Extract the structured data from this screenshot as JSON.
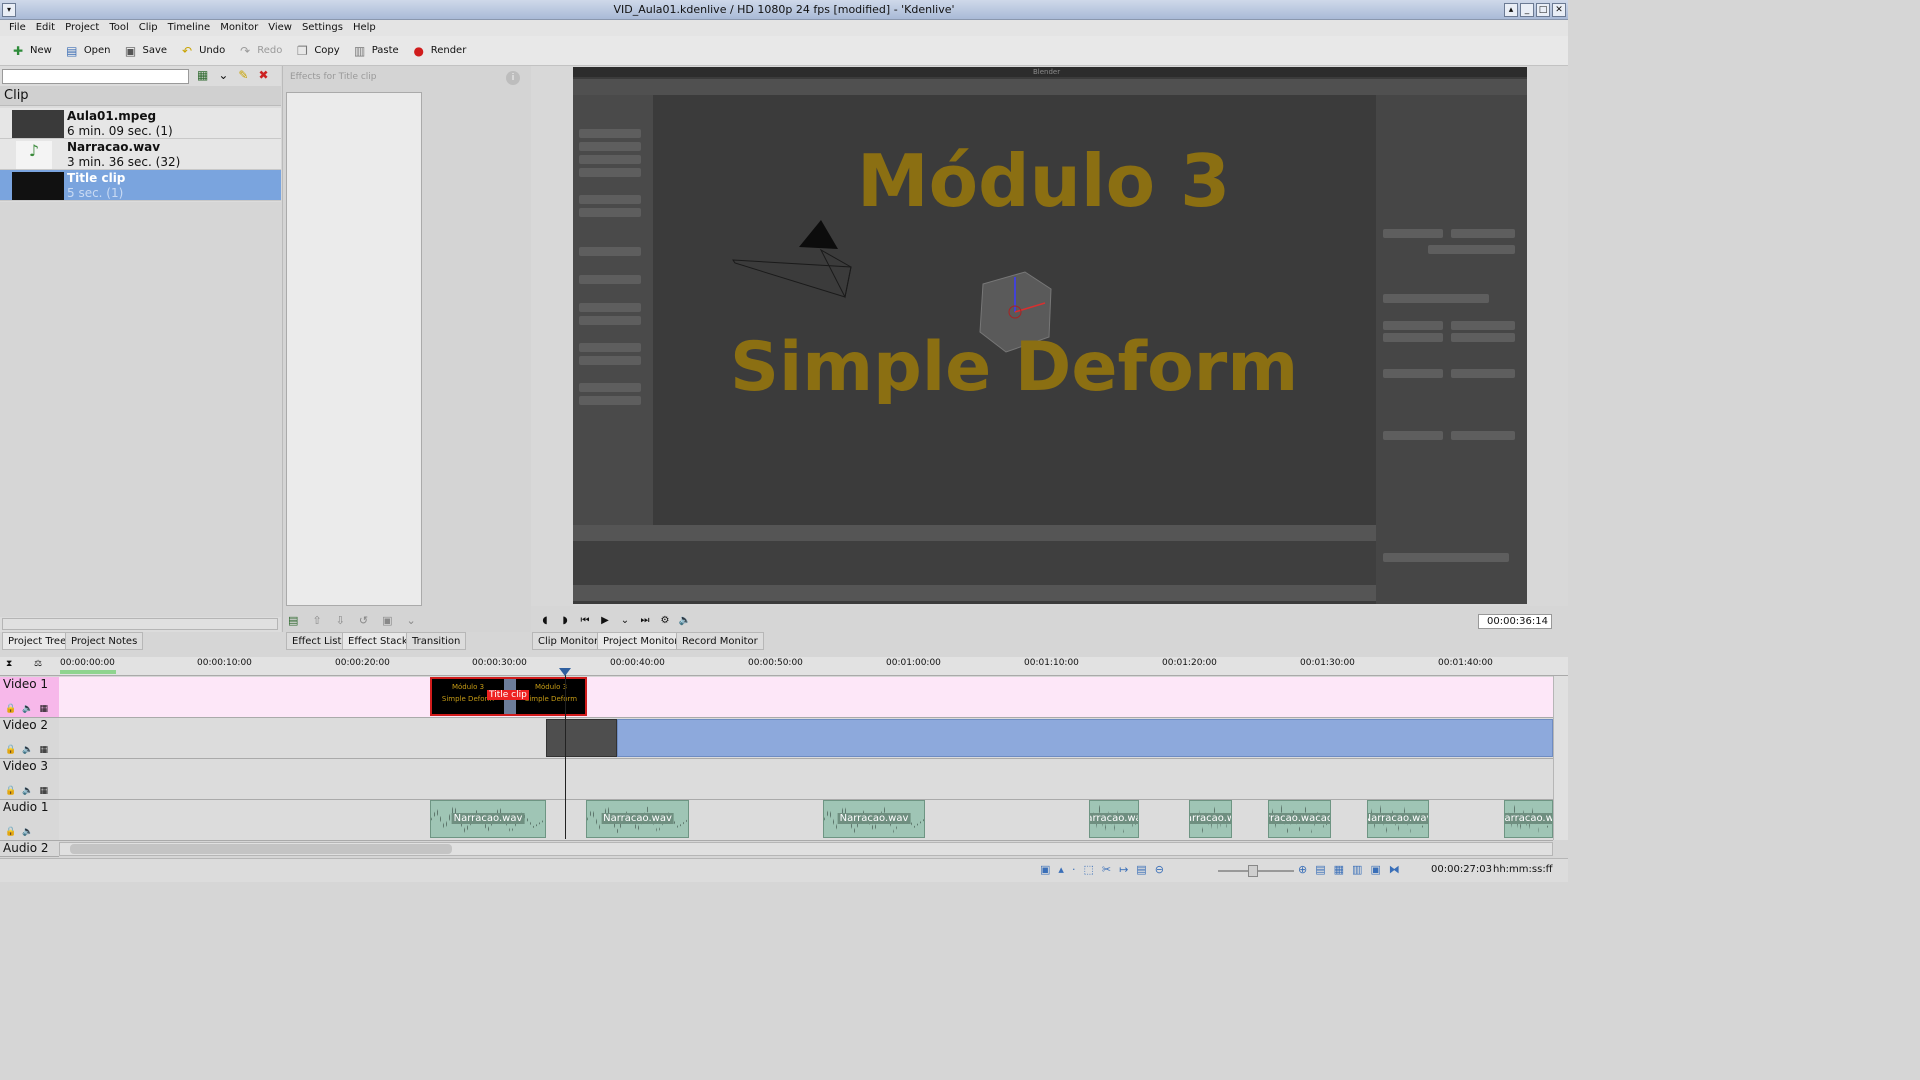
{
  "window": {
    "title": "VID_Aula01.kdenlive / HD 1080p 24 fps [modified] - 'Kdenlive'"
  },
  "menu": [
    "File",
    "Edit",
    "Project",
    "Tool",
    "Clip",
    "Timeline",
    "Monitor",
    "View",
    "Settings",
    "Help"
  ],
  "toolbar": {
    "new": "New",
    "open": "Open",
    "save": "Save",
    "undo": "Undo",
    "redo": "Redo",
    "copy": "Copy",
    "paste": "Paste",
    "render": "Render"
  },
  "clips": {
    "header": "Clip",
    "items": [
      {
        "name": "Aula01.mpeg",
        "info": "6 min. 09 sec. (1)"
      },
      {
        "name": "Narracao.wav",
        "info": "3 min. 36 sec. (32)"
      },
      {
        "name": "Title clip",
        "info": "5 sec. (1)"
      }
    ]
  },
  "effects": {
    "placeholder": "Effects for Title clip"
  },
  "monitor": {
    "app_name": "Blender",
    "title_line1": "Módulo 3",
    "title_line2": "Simple Deform",
    "timecode": "00:00:36:14"
  },
  "tabs_left": {
    "project_tree": "Project Tree",
    "project_notes": "Project Notes"
  },
  "tabs_mid": {
    "effect_list": "Effect List",
    "effect_stack": "Effect Stack",
    "transition": "Transition"
  },
  "tabs_right": {
    "clip_monitor": "Clip Monitor",
    "project_monitor": "Project Monitor",
    "record_monitor": "Record Monitor"
  },
  "timeline": {
    "ruler": [
      "00:00:00:00",
      "00:00:10:00",
      "00:00:20:00",
      "00:00:30:00",
      "00:00:40:00",
      "00:00:50:00",
      "00:01:00:00",
      "00:01:10:00",
      "00:01:20:00",
      "00:01:30:00",
      "00:01:40:00"
    ],
    "tracks": [
      "Video 1",
      "Video 2",
      "Video 3",
      "Audio 1",
      "Audio 2"
    ],
    "title_clip_label": "Title clip",
    "title_thumb": {
      "line1": "Módulo 3",
      "line2": "Simple Deform"
    },
    "audio_labels": [
      "Narracao.wav",
      "Narracao.wav",
      "Narracao.wav",
      "arracao.wa",
      "arracao.w",
      "rracao.wacao",
      "Narracao.wav",
      "Narracao.wa"
    ]
  },
  "status": {
    "timecode": "00:00:27:03",
    "format": "hh:mm:ss:ff"
  }
}
